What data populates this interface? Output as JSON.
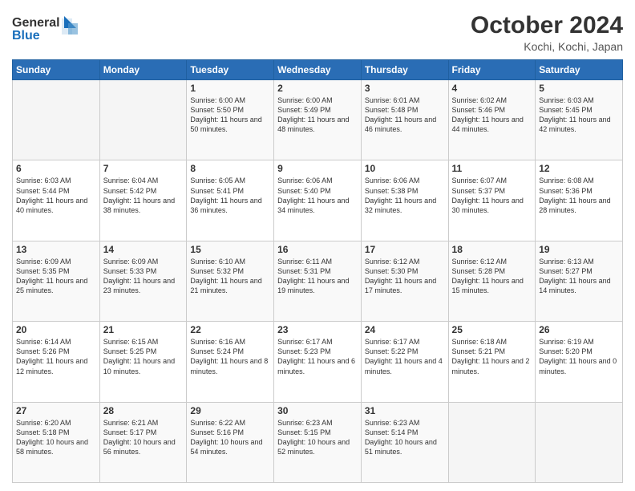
{
  "logo": {
    "line1": "General",
    "line2": "Blue"
  },
  "title": "October 2024",
  "subtitle": "Kochi, Kochi, Japan",
  "days_of_week": [
    "Sunday",
    "Monday",
    "Tuesday",
    "Wednesday",
    "Thursday",
    "Friday",
    "Saturday"
  ],
  "weeks": [
    [
      {
        "day": "",
        "sunrise": "",
        "sunset": "",
        "daylight": ""
      },
      {
        "day": "",
        "sunrise": "",
        "sunset": "",
        "daylight": ""
      },
      {
        "day": "1",
        "sunrise": "Sunrise: 6:00 AM",
        "sunset": "Sunset: 5:50 PM",
        "daylight": "Daylight: 11 hours and 50 minutes."
      },
      {
        "day": "2",
        "sunrise": "Sunrise: 6:00 AM",
        "sunset": "Sunset: 5:49 PM",
        "daylight": "Daylight: 11 hours and 48 minutes."
      },
      {
        "day": "3",
        "sunrise": "Sunrise: 6:01 AM",
        "sunset": "Sunset: 5:48 PM",
        "daylight": "Daylight: 11 hours and 46 minutes."
      },
      {
        "day": "4",
        "sunrise": "Sunrise: 6:02 AM",
        "sunset": "Sunset: 5:46 PM",
        "daylight": "Daylight: 11 hours and 44 minutes."
      },
      {
        "day": "5",
        "sunrise": "Sunrise: 6:03 AM",
        "sunset": "Sunset: 5:45 PM",
        "daylight": "Daylight: 11 hours and 42 minutes."
      }
    ],
    [
      {
        "day": "6",
        "sunrise": "Sunrise: 6:03 AM",
        "sunset": "Sunset: 5:44 PM",
        "daylight": "Daylight: 11 hours and 40 minutes."
      },
      {
        "day": "7",
        "sunrise": "Sunrise: 6:04 AM",
        "sunset": "Sunset: 5:42 PM",
        "daylight": "Daylight: 11 hours and 38 minutes."
      },
      {
        "day": "8",
        "sunrise": "Sunrise: 6:05 AM",
        "sunset": "Sunset: 5:41 PM",
        "daylight": "Daylight: 11 hours and 36 minutes."
      },
      {
        "day": "9",
        "sunrise": "Sunrise: 6:06 AM",
        "sunset": "Sunset: 5:40 PM",
        "daylight": "Daylight: 11 hours and 34 minutes."
      },
      {
        "day": "10",
        "sunrise": "Sunrise: 6:06 AM",
        "sunset": "Sunset: 5:38 PM",
        "daylight": "Daylight: 11 hours and 32 minutes."
      },
      {
        "day": "11",
        "sunrise": "Sunrise: 6:07 AM",
        "sunset": "Sunset: 5:37 PM",
        "daylight": "Daylight: 11 hours and 30 minutes."
      },
      {
        "day": "12",
        "sunrise": "Sunrise: 6:08 AM",
        "sunset": "Sunset: 5:36 PM",
        "daylight": "Daylight: 11 hours and 28 minutes."
      }
    ],
    [
      {
        "day": "13",
        "sunrise": "Sunrise: 6:09 AM",
        "sunset": "Sunset: 5:35 PM",
        "daylight": "Daylight: 11 hours and 25 minutes."
      },
      {
        "day": "14",
        "sunrise": "Sunrise: 6:09 AM",
        "sunset": "Sunset: 5:33 PM",
        "daylight": "Daylight: 11 hours and 23 minutes."
      },
      {
        "day": "15",
        "sunrise": "Sunrise: 6:10 AM",
        "sunset": "Sunset: 5:32 PM",
        "daylight": "Daylight: 11 hours and 21 minutes."
      },
      {
        "day": "16",
        "sunrise": "Sunrise: 6:11 AM",
        "sunset": "Sunset: 5:31 PM",
        "daylight": "Daylight: 11 hours and 19 minutes."
      },
      {
        "day": "17",
        "sunrise": "Sunrise: 6:12 AM",
        "sunset": "Sunset: 5:30 PM",
        "daylight": "Daylight: 11 hours and 17 minutes."
      },
      {
        "day": "18",
        "sunrise": "Sunrise: 6:12 AM",
        "sunset": "Sunset: 5:28 PM",
        "daylight": "Daylight: 11 hours and 15 minutes."
      },
      {
        "day": "19",
        "sunrise": "Sunrise: 6:13 AM",
        "sunset": "Sunset: 5:27 PM",
        "daylight": "Daylight: 11 hours and 14 minutes."
      }
    ],
    [
      {
        "day": "20",
        "sunrise": "Sunrise: 6:14 AM",
        "sunset": "Sunset: 5:26 PM",
        "daylight": "Daylight: 11 hours and 12 minutes."
      },
      {
        "day": "21",
        "sunrise": "Sunrise: 6:15 AM",
        "sunset": "Sunset: 5:25 PM",
        "daylight": "Daylight: 11 hours and 10 minutes."
      },
      {
        "day": "22",
        "sunrise": "Sunrise: 6:16 AM",
        "sunset": "Sunset: 5:24 PM",
        "daylight": "Daylight: 11 hours and 8 minutes."
      },
      {
        "day": "23",
        "sunrise": "Sunrise: 6:17 AM",
        "sunset": "Sunset: 5:23 PM",
        "daylight": "Daylight: 11 hours and 6 minutes."
      },
      {
        "day": "24",
        "sunrise": "Sunrise: 6:17 AM",
        "sunset": "Sunset: 5:22 PM",
        "daylight": "Daylight: 11 hours and 4 minutes."
      },
      {
        "day": "25",
        "sunrise": "Sunrise: 6:18 AM",
        "sunset": "Sunset: 5:21 PM",
        "daylight": "Daylight: 11 hours and 2 minutes."
      },
      {
        "day": "26",
        "sunrise": "Sunrise: 6:19 AM",
        "sunset": "Sunset: 5:20 PM",
        "daylight": "Daylight: 11 hours and 0 minutes."
      }
    ],
    [
      {
        "day": "27",
        "sunrise": "Sunrise: 6:20 AM",
        "sunset": "Sunset: 5:18 PM",
        "daylight": "Daylight: 10 hours and 58 minutes."
      },
      {
        "day": "28",
        "sunrise": "Sunrise: 6:21 AM",
        "sunset": "Sunset: 5:17 PM",
        "daylight": "Daylight: 10 hours and 56 minutes."
      },
      {
        "day": "29",
        "sunrise": "Sunrise: 6:22 AM",
        "sunset": "Sunset: 5:16 PM",
        "daylight": "Daylight: 10 hours and 54 minutes."
      },
      {
        "day": "30",
        "sunrise": "Sunrise: 6:23 AM",
        "sunset": "Sunset: 5:15 PM",
        "daylight": "Daylight: 10 hours and 52 minutes."
      },
      {
        "day": "31",
        "sunrise": "Sunrise: 6:23 AM",
        "sunset": "Sunset: 5:14 PM",
        "daylight": "Daylight: 10 hours and 51 minutes."
      },
      {
        "day": "",
        "sunrise": "",
        "sunset": "",
        "daylight": ""
      },
      {
        "day": "",
        "sunrise": "",
        "sunset": "",
        "daylight": ""
      }
    ]
  ]
}
